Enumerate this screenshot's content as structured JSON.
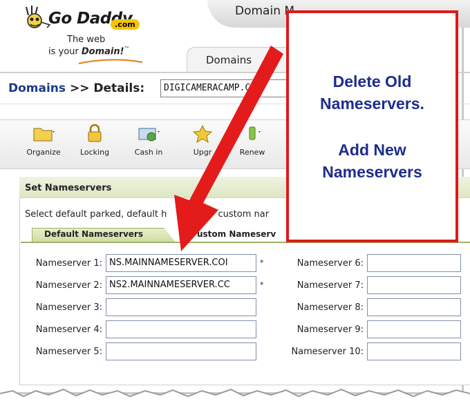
{
  "logo": {
    "brand": "Go Daddy",
    "com_badge": ".com",
    "tagline_line1": "The web",
    "tagline_line2_prefix": "is your ",
    "tagline_line2_bold": "Domain!",
    "tagline_line2_tm": "™"
  },
  "header": {
    "title": "Domain M"
  },
  "top_tab": {
    "label": "Domains"
  },
  "breadcrumb": {
    "link": "Domains",
    "separator": " >> ",
    "current": "Details:",
    "domain_value": "DIGICAMERACAMP.CO"
  },
  "toolbar": {
    "items": [
      {
        "label": "Organize",
        "icon": "folder-icon"
      },
      {
        "label": "Locking",
        "icon": "lock-icon"
      },
      {
        "label": "Cash in",
        "icon": "cash-in-icon"
      },
      {
        "label": "Upgr",
        "icon": "upgrade-icon"
      },
      {
        "label": "Renew",
        "icon": "renew-icon"
      }
    ]
  },
  "panel": {
    "title": "Set Nameservers",
    "description": "Select default parked, default h",
    "description_tail": "custom nar",
    "tab_default": "Default Nameservers",
    "tab_custom": "ustom Nameserv"
  },
  "nameservers": {
    "left": [
      {
        "label": "Nameserver 1:",
        "value": "NS.MAINNAMESERVER.COI",
        "required": "*"
      },
      {
        "label": "Nameserver 2:",
        "value": "NS2.MAINNAMESERVER.CC",
        "required": "*"
      },
      {
        "label": "Nameserver 3:",
        "value": ""
      },
      {
        "label": "Nameserver 4:",
        "value": ""
      },
      {
        "label": "Nameserver 5:",
        "value": ""
      }
    ],
    "right": [
      {
        "label": "Nameserver 6:",
        "value": ""
      },
      {
        "label": "Nameserver 7:",
        "value": ""
      },
      {
        "label": "Nameserver 8:",
        "value": ""
      },
      {
        "label": "Nameserver 9:",
        "value": ""
      },
      {
        "label": "Nameserver 10:",
        "value": ""
      }
    ]
  },
  "callout": {
    "line1": "Delete Old",
    "line2": "Nameservers.",
    "line3": "Add New",
    "line4": "Nameservers",
    "border_color": "#e01818",
    "text_color": "#1d2c8f"
  },
  "arrow_color": "#e31b1b"
}
